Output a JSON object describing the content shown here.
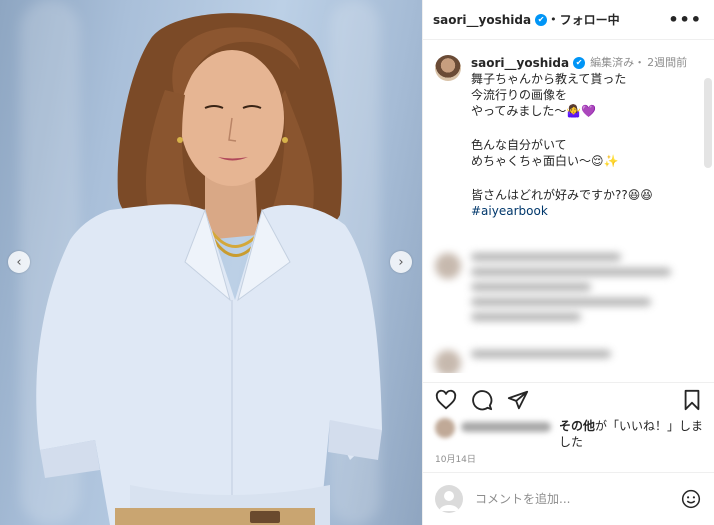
{
  "post": {
    "username": "saori__yoshida",
    "follow_label": "フォロー中",
    "dot": "•",
    "more_label": "•••"
  },
  "caption": {
    "username": "saori__yoshida",
    "edited": "編集済み・",
    "time": "2週間前",
    "lines": [
      "舞子ちゃんから教えて貰った",
      "今流行りの画像を",
      "やってみました〜🤷‍♀️💜",
      "",
      "色んな自分がいて",
      "めちゃくちゃ面白い〜😌✨",
      "",
      "皆さんはどれが好みですか??😆😆"
    ],
    "hashtag": "#aiyearbook"
  },
  "likes": {
    "prefix": "その他",
    "suffix": "が「いいね！」しました"
  },
  "date": "10月14日",
  "comment": {
    "placeholder": "コメントを追加..."
  },
  "icons": {
    "prev": "chevron-left-icon",
    "next": "chevron-right-icon",
    "like": "heart-icon",
    "comment": "comment-icon",
    "share": "paper-plane-icon",
    "save": "bookmark-icon",
    "emoji": "smiley-icon"
  },
  "colors": {
    "verified": "#0095f6",
    "hashtag": "#00376b",
    "muted": "#8e8e8e",
    "shirt": "#dfe8f5",
    "background": "#a9bfd9"
  }
}
